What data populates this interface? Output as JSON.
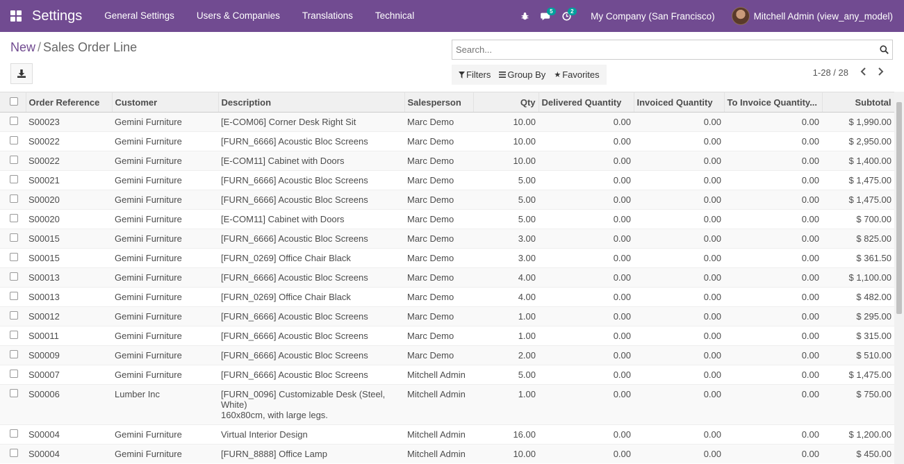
{
  "navbar": {
    "app_title": "Settings",
    "menu": [
      "General Settings",
      "Users & Companies",
      "Translations",
      "Technical"
    ],
    "messages_badge": "5",
    "activities_badge": "2",
    "company": "My Company (San Francisco)",
    "user": "Mitchell Admin (view_any_model)"
  },
  "breadcrumb": {
    "new": "New",
    "sep": "/",
    "current": "Sales Order Line"
  },
  "search": {
    "placeholder": "Search..."
  },
  "filters": {
    "filters": "Filters",
    "group_by": "Group By",
    "favorites": "Favorites"
  },
  "pager": {
    "value": "1-28 / 28"
  },
  "table": {
    "headers": [
      "Order Reference",
      "Customer",
      "Description",
      "Salesperson",
      "Qty",
      "Delivered Quantity",
      "Invoiced Quantity",
      "To Invoice Quantity...",
      "Subtotal"
    ],
    "rows": [
      [
        "S00023",
        "Gemini Furniture",
        "[E-COM06] Corner Desk Right Sit",
        "Marc Demo",
        "10.00",
        "0.00",
        "0.00",
        "0.00",
        "$ 1,990.00"
      ],
      [
        "S00022",
        "Gemini Furniture",
        "[FURN_6666] Acoustic Bloc Screens",
        "Marc Demo",
        "10.00",
        "0.00",
        "0.00",
        "0.00",
        "$ 2,950.00"
      ],
      [
        "S00022",
        "Gemini Furniture",
        "[E-COM11] Cabinet with Doors",
        "Marc Demo",
        "10.00",
        "0.00",
        "0.00",
        "0.00",
        "$ 1,400.00"
      ],
      [
        "S00021",
        "Gemini Furniture",
        "[FURN_6666] Acoustic Bloc Screens",
        "Marc Demo",
        "5.00",
        "0.00",
        "0.00",
        "0.00",
        "$ 1,475.00"
      ],
      [
        "S00020",
        "Gemini Furniture",
        "[FURN_6666] Acoustic Bloc Screens",
        "Marc Demo",
        "5.00",
        "0.00",
        "0.00",
        "0.00",
        "$ 1,475.00"
      ],
      [
        "S00020",
        "Gemini Furniture",
        "[E-COM11] Cabinet with Doors",
        "Marc Demo",
        "5.00",
        "0.00",
        "0.00",
        "0.00",
        "$ 700.00"
      ],
      [
        "S00015",
        "Gemini Furniture",
        "[FURN_6666] Acoustic Bloc Screens",
        "Marc Demo",
        "3.00",
        "0.00",
        "0.00",
        "0.00",
        "$ 825.00"
      ],
      [
        "S00015",
        "Gemini Furniture",
        "[FURN_0269] Office Chair Black",
        "Marc Demo",
        "3.00",
        "0.00",
        "0.00",
        "0.00",
        "$ 361.50"
      ],
      [
        "S00013",
        "Gemini Furniture",
        "[FURN_6666] Acoustic Bloc Screens",
        "Marc Demo",
        "4.00",
        "0.00",
        "0.00",
        "0.00",
        "$ 1,100.00"
      ],
      [
        "S00013",
        "Gemini Furniture",
        "[FURN_0269] Office Chair Black",
        "Marc Demo",
        "4.00",
        "0.00",
        "0.00",
        "0.00",
        "$ 482.00"
      ],
      [
        "S00012",
        "Gemini Furniture",
        "[FURN_6666] Acoustic Bloc Screens",
        "Marc Demo",
        "1.00",
        "0.00",
        "0.00",
        "0.00",
        "$ 295.00"
      ],
      [
        "S00011",
        "Gemini Furniture",
        "[FURN_6666] Acoustic Bloc Screens",
        "Marc Demo",
        "1.00",
        "0.00",
        "0.00",
        "0.00",
        "$ 315.00"
      ],
      [
        "S00009",
        "Gemini Furniture",
        "[FURN_6666] Acoustic Bloc Screens",
        "Marc Demo",
        "2.00",
        "0.00",
        "0.00",
        "0.00",
        "$ 510.00"
      ],
      [
        "S00007",
        "Gemini Furniture",
        "[FURN_6666] Acoustic Bloc Screens",
        "Mitchell Admin",
        "5.00",
        "0.00",
        "0.00",
        "0.00",
        "$ 1,475.00"
      ],
      [
        "S00006",
        "Lumber Inc",
        "[FURN_0096] Customizable Desk (Steel, White)\n160x80cm, with large legs.",
        "Mitchell Admin",
        "1.00",
        "0.00",
        "0.00",
        "0.00",
        "$ 750.00"
      ],
      [
        "S00004",
        "Gemini Furniture",
        "Virtual Interior Design",
        "Mitchell Admin",
        "16.00",
        "0.00",
        "0.00",
        "0.00",
        "$ 1,200.00"
      ],
      [
        "S00004",
        "Gemini Furniture",
        "[FURN_8888] Office Lamp",
        "Mitchell Admin",
        "10.00",
        "0.00",
        "0.00",
        "0.00",
        "$ 450.00"
      ]
    ]
  },
  "colors": {
    "brand": "#714b91",
    "badge": "#00a09d"
  }
}
